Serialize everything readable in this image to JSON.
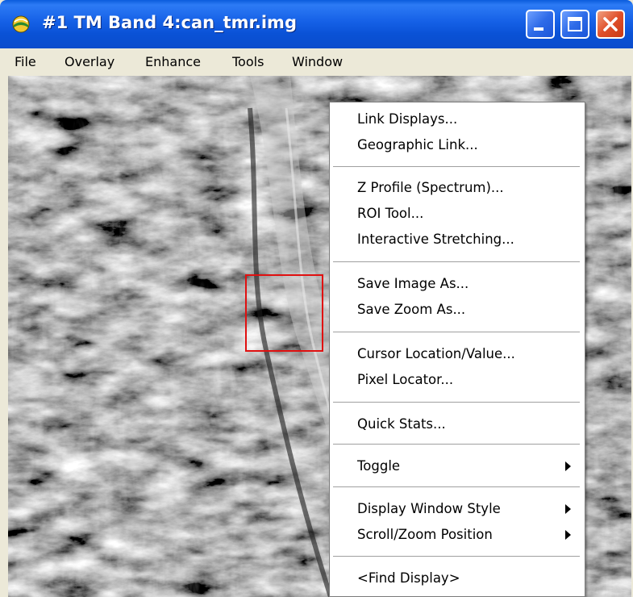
{
  "window": {
    "title": "#1 TM Band 4:can_tmr.img",
    "buttons": {
      "minimize": "minimize-icon",
      "maximize": "maximize-icon",
      "close": "close-icon"
    },
    "colors": {
      "titlebar": "#0a52d6",
      "close_button": "#e0502a",
      "roi_box": "#e01010"
    }
  },
  "menubar": {
    "items": [
      "File",
      "Overlay",
      "Enhance",
      "Tools",
      "Window"
    ]
  },
  "context_menu": {
    "groups": [
      [
        {
          "label": "Link Displays..."
        },
        {
          "label": "Geographic Link..."
        }
      ],
      [
        {
          "label": "Z Profile (Spectrum)..."
        },
        {
          "label": "ROI Tool..."
        },
        {
          "label": "Interactive Stretching..."
        }
      ],
      [
        {
          "label": "Save Image As..."
        },
        {
          "label": "Save Zoom As..."
        }
      ],
      [
        {
          "label": "Cursor Location/Value..."
        },
        {
          "label": "Pixel Locator..."
        }
      ],
      [
        {
          "label": "Quick Stats..."
        }
      ],
      [
        {
          "label": "Toggle",
          "submenu": true
        }
      ],
      [
        {
          "label": "Display Window Style",
          "submenu": true
        },
        {
          "label": "Scroll/Zoom Position",
          "submenu": true
        }
      ],
      [
        {
          "label": "<Find Display>"
        }
      ]
    ]
  }
}
